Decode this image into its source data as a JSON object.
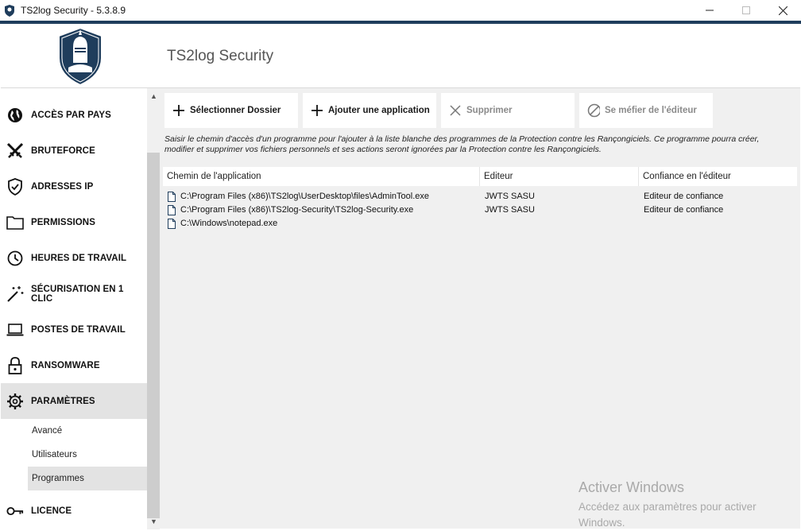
{
  "window": {
    "title": "TS2log Security - 5.3.8.9",
    "minimize_label": "minimize",
    "maximize_label": "maximize",
    "close_label": "close"
  },
  "header": {
    "app_title": "TS2log Security"
  },
  "sidebar": {
    "items": [
      {
        "label": "ACCÈS PAR PAYS",
        "icon": "globe-icon"
      },
      {
        "label": "BRUTEFORCE",
        "icon": "swords-icon"
      },
      {
        "label": "ADRESSES IP",
        "icon": "shield-check-icon"
      },
      {
        "label": "PERMISSIONS",
        "icon": "folder-icon"
      },
      {
        "label": "HEURES DE TRAVAIL",
        "icon": "clock-icon"
      },
      {
        "label": "SÉCURISATION EN 1 CLIC",
        "icon": "magic-wand-icon"
      },
      {
        "label": "POSTES DE TRAVAIL",
        "icon": "laptop-icon"
      },
      {
        "label": "RANSOMWARE",
        "icon": "lock-icon"
      },
      {
        "label": "PARAMÈTRES",
        "icon": "gear-icon",
        "active": true
      }
    ],
    "sub_items": [
      {
        "label": "Avancé"
      },
      {
        "label": "Utilisateurs"
      },
      {
        "label": "Programmes",
        "active": true
      }
    ],
    "licence": {
      "label": "LICENCE",
      "icon": "key-icon"
    }
  },
  "toolbar": {
    "select_folder": "Sélectionner Dossier",
    "add_application": "Ajouter une application",
    "delete": "Supprimer",
    "distrust_editor": "Se méfier de l'éditeur"
  },
  "help_text": "Saisir le chemin d'accès d'un programme pour l'ajouter à la liste blanche des programmes de la Protection contre les Rançongiciels. Ce programme pourra créer, modifier et supprimer vos fichiers personnels et ses actions seront ignorées par la Protection contre les Rançongiciels.",
  "table": {
    "columns": [
      "Chemin de l'application",
      "Editeur",
      "Confiance en l'éditeur"
    ],
    "rows": [
      {
        "path": "C:\\Program Files (x86)\\TS2log\\UserDesktop\\files\\AdminTool.exe",
        "editor": "JWTS SASU",
        "trust": "Editeur de confiance"
      },
      {
        "path": "C:\\Program Files (x86)\\TS2log-Security\\TS2log-Security.exe",
        "editor": "JWTS SASU",
        "trust": "Editeur de confiance"
      },
      {
        "path": "C:\\Windows\\notepad.exe",
        "editor": "",
        "trust": ""
      }
    ]
  },
  "watermark": {
    "title": "Activer Windows",
    "subtitle": "Accédez aux paramètres pour activer Windows."
  },
  "colors": {
    "accent": "#1f3d5c",
    "active_bg": "#e3e3e3",
    "content_bg": "#f0f0f0"
  }
}
